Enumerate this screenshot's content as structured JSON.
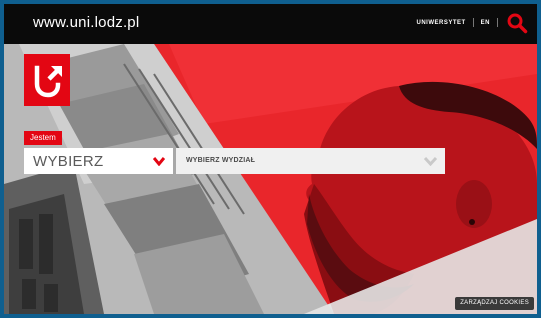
{
  "header": {
    "domain": "www.uni.lodz.pl",
    "nav_university": "UNIWERSYTET",
    "nav_lang": "EN",
    "search_icon": "search-icon"
  },
  "selector": {
    "tag": "Jestem",
    "primary_value": "WYBIERZ",
    "faculty_value": "WYBIERZ WYDZIAŁ"
  },
  "footer": {
    "cookies_label": "ZARZĄDZAJ COOKIES"
  },
  "colors": {
    "brand_red": "#e30613",
    "topbar": "#0a0a0a"
  }
}
